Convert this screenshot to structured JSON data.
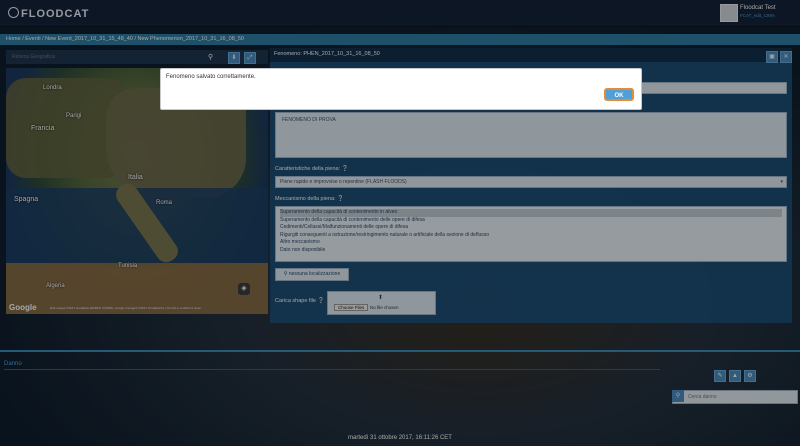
{
  "app": {
    "logo": "FLOODCAT"
  },
  "user": {
    "name": "Floodcat Test",
    "subtitle": "FCAT_edit_CIMA"
  },
  "breadcrumb": [
    "Home",
    "Eventi",
    "New Event_2017_10_31_15_48_40",
    "New Phenomenon_2017_10_31_16_08_50"
  ],
  "search": {
    "placeholder": "Ricerca Geografica"
  },
  "map": {
    "labels": [
      "Londra",
      "Parigi",
      "Francia",
      "Italia",
      "Roma",
      "Spagna",
      "Tunisia",
      "Algeria"
    ],
    "google": "Google",
    "attribution": "Dati mappa ©2017 GeoBasis-DE/BKG (©2009), Google Immagini ©2017 TerraMetrics | Termini e condizioni d'uso"
  },
  "form": {
    "title": "Fenomeno: PHEN_2017_10_31_16_08_50",
    "description_value": "FENOMENO DI PROVA",
    "piena_label": "Caratteristiche della piena: ❔",
    "piena_value": "Piene rapide e improvvise o repentine (FLASH FLOODS)",
    "meccanismo_label": "Meccanismo della piena: ❔",
    "meccanismo_options": [
      "Superamento della capacità di contenimento in alveo",
      "Superamento della capacità di contenimento delle opere di difesa",
      "Cedimenti/Collassi/Malfunzionamenti delle opere di difesa",
      "Rigurgiti conseguenti a ostruzione/restringimento naturale o artificiale della sezione di deflusso",
      "Altro meccanismo",
      "Dato non disponibile"
    ],
    "loc_button": "nessuna localizzazione",
    "shape_label": "Carica shape file ❔",
    "choose_file": "Choose Files",
    "no_file": "No file chosen"
  },
  "modal": {
    "message": "Fenomeno salvato correttamente.",
    "ok": "OK"
  },
  "danno": {
    "label": "Danno",
    "search_placeholder": "Cerca danno"
  },
  "footer": {
    "datetime": "martedì 31 ottobre 2017, 16:11:26 CET"
  }
}
